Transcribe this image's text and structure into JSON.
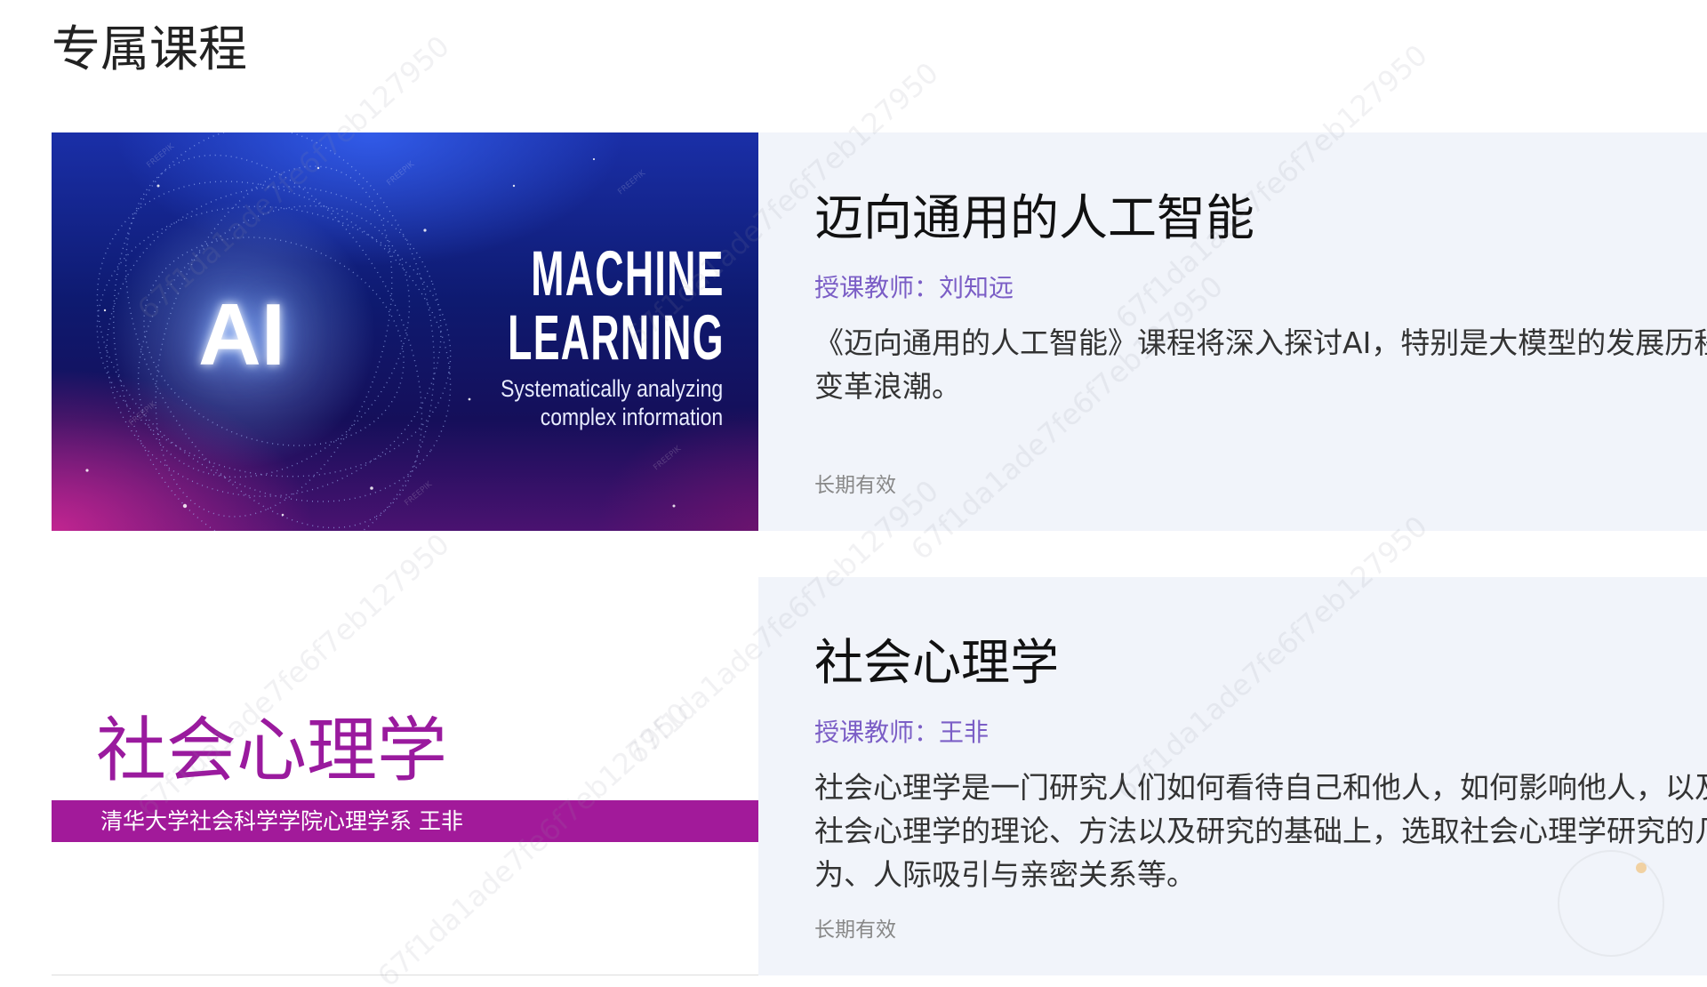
{
  "page": {
    "title": "专属课程",
    "watermark": "67f1da1ade7fe6f7eb127950"
  },
  "courses": [
    {
      "title": "迈向通用的人工智能",
      "teacher_label": "授课教师：刘知远",
      "description_lines": [
        "《迈向通用的人工智能》课程将深入探讨AI，特别是大模型的发展历程",
        "变革浪潮。"
      ],
      "validity": "长期有效",
      "cover": {
        "big_text": "AI",
        "headline_lines": [
          "MACHINE",
          "LEARNING"
        ],
        "tagline_lines": [
          "Systematically analyzing",
          "complex information"
        ],
        "watermark": "FREEPIK"
      }
    },
    {
      "title": "社会心理学",
      "teacher_label": "授课教师：王非",
      "description_lines": [
        "社会心理学是一门研究人们如何看待自己和他人，如何影响他人，以及",
        "社会心理学的理论、方法以及研究的基础上，选取社会心理学研究的几",
        "为、人际吸引与亲密关系等。"
      ],
      "validity": "长期有效",
      "cover": {
        "title": "社会心理学",
        "subtitle": "清华大学社会科学学院心理学系 王非"
      }
    }
  ],
  "colors": {
    "panel_bg": "#f1f4fa",
    "teacher_text": "#7b5ec6",
    "psy_purple": "#a21a9a",
    "validity_text": "#888888"
  }
}
